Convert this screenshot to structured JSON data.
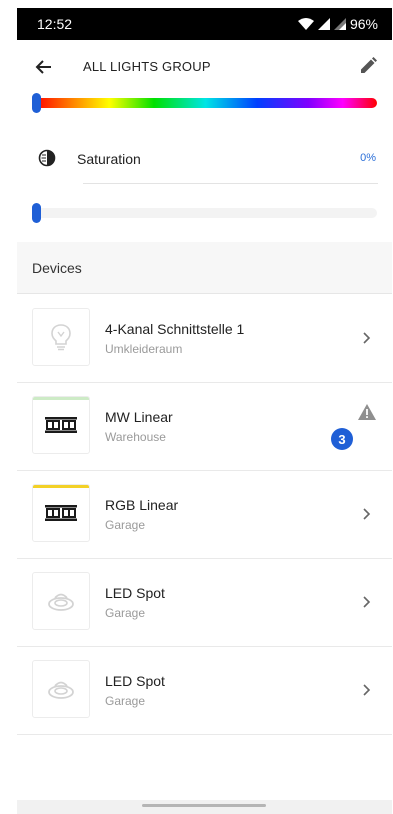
{
  "status_bar": {
    "time": "12:52",
    "battery": "96%"
  },
  "header": {
    "title": "ALL LIGHTS GROUP"
  },
  "hue": {
    "level": 0.0
  },
  "saturation": {
    "label": "Saturation",
    "value": "0%",
    "level": 0.0
  },
  "devices_section": {
    "title": "Devices"
  },
  "devices": [
    {
      "name": "4-Kanal Schnittstelle 1",
      "room": "Umkleideraum",
      "icon": "bulb-icon",
      "status_color": "",
      "state": "chevron"
    },
    {
      "name": "MW Linear",
      "room": "Warehouse",
      "icon": "linear-fixture-icon",
      "status_color": "#cdebc6",
      "state": "warning",
      "badge": "3"
    },
    {
      "name": "RGB Linear",
      "room": "Garage",
      "icon": "linear-fixture-icon",
      "status_color": "#f3d126",
      "state": "chevron"
    },
    {
      "name": "LED Spot",
      "room": "Garage",
      "icon": "spot-icon",
      "status_color": "",
      "state": "chevron"
    },
    {
      "name": "LED Spot",
      "room": "Garage",
      "icon": "spot-icon",
      "status_color": "",
      "state": "chevron"
    }
  ],
  "colors": {
    "accent": "#1f5fd6",
    "warning_icon": "#8f8f8f"
  }
}
